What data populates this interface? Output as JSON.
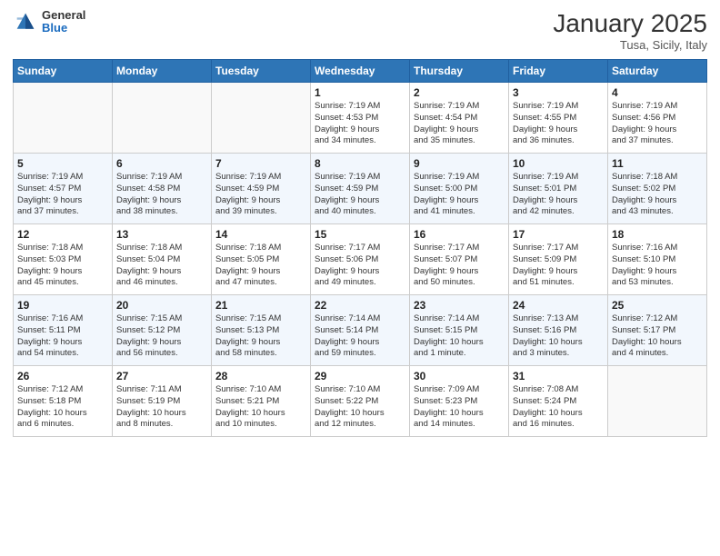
{
  "header": {
    "logo_general": "General",
    "logo_blue": "Blue",
    "month_title": "January 2025",
    "location": "Tusa, Sicily, Italy"
  },
  "weekdays": [
    "Sunday",
    "Monday",
    "Tuesday",
    "Wednesday",
    "Thursday",
    "Friday",
    "Saturday"
  ],
  "weeks": [
    [
      {
        "day": "",
        "info": ""
      },
      {
        "day": "",
        "info": ""
      },
      {
        "day": "",
        "info": ""
      },
      {
        "day": "1",
        "info": "Sunrise: 7:19 AM\nSunset: 4:53 PM\nDaylight: 9 hours\nand 34 minutes."
      },
      {
        "day": "2",
        "info": "Sunrise: 7:19 AM\nSunset: 4:54 PM\nDaylight: 9 hours\nand 35 minutes."
      },
      {
        "day": "3",
        "info": "Sunrise: 7:19 AM\nSunset: 4:55 PM\nDaylight: 9 hours\nand 36 minutes."
      },
      {
        "day": "4",
        "info": "Sunrise: 7:19 AM\nSunset: 4:56 PM\nDaylight: 9 hours\nand 37 minutes."
      }
    ],
    [
      {
        "day": "5",
        "info": "Sunrise: 7:19 AM\nSunset: 4:57 PM\nDaylight: 9 hours\nand 37 minutes."
      },
      {
        "day": "6",
        "info": "Sunrise: 7:19 AM\nSunset: 4:58 PM\nDaylight: 9 hours\nand 38 minutes."
      },
      {
        "day": "7",
        "info": "Sunrise: 7:19 AM\nSunset: 4:59 PM\nDaylight: 9 hours\nand 39 minutes."
      },
      {
        "day": "8",
        "info": "Sunrise: 7:19 AM\nSunset: 4:59 PM\nDaylight: 9 hours\nand 40 minutes."
      },
      {
        "day": "9",
        "info": "Sunrise: 7:19 AM\nSunset: 5:00 PM\nDaylight: 9 hours\nand 41 minutes."
      },
      {
        "day": "10",
        "info": "Sunrise: 7:19 AM\nSunset: 5:01 PM\nDaylight: 9 hours\nand 42 minutes."
      },
      {
        "day": "11",
        "info": "Sunrise: 7:18 AM\nSunset: 5:02 PM\nDaylight: 9 hours\nand 43 minutes."
      }
    ],
    [
      {
        "day": "12",
        "info": "Sunrise: 7:18 AM\nSunset: 5:03 PM\nDaylight: 9 hours\nand 45 minutes."
      },
      {
        "day": "13",
        "info": "Sunrise: 7:18 AM\nSunset: 5:04 PM\nDaylight: 9 hours\nand 46 minutes."
      },
      {
        "day": "14",
        "info": "Sunrise: 7:18 AM\nSunset: 5:05 PM\nDaylight: 9 hours\nand 47 minutes."
      },
      {
        "day": "15",
        "info": "Sunrise: 7:17 AM\nSunset: 5:06 PM\nDaylight: 9 hours\nand 49 minutes."
      },
      {
        "day": "16",
        "info": "Sunrise: 7:17 AM\nSunset: 5:07 PM\nDaylight: 9 hours\nand 50 minutes."
      },
      {
        "day": "17",
        "info": "Sunrise: 7:17 AM\nSunset: 5:09 PM\nDaylight: 9 hours\nand 51 minutes."
      },
      {
        "day": "18",
        "info": "Sunrise: 7:16 AM\nSunset: 5:10 PM\nDaylight: 9 hours\nand 53 minutes."
      }
    ],
    [
      {
        "day": "19",
        "info": "Sunrise: 7:16 AM\nSunset: 5:11 PM\nDaylight: 9 hours\nand 54 minutes."
      },
      {
        "day": "20",
        "info": "Sunrise: 7:15 AM\nSunset: 5:12 PM\nDaylight: 9 hours\nand 56 minutes."
      },
      {
        "day": "21",
        "info": "Sunrise: 7:15 AM\nSunset: 5:13 PM\nDaylight: 9 hours\nand 58 minutes."
      },
      {
        "day": "22",
        "info": "Sunrise: 7:14 AM\nSunset: 5:14 PM\nDaylight: 9 hours\nand 59 minutes."
      },
      {
        "day": "23",
        "info": "Sunrise: 7:14 AM\nSunset: 5:15 PM\nDaylight: 10 hours\nand 1 minute."
      },
      {
        "day": "24",
        "info": "Sunrise: 7:13 AM\nSunset: 5:16 PM\nDaylight: 10 hours\nand 3 minutes."
      },
      {
        "day": "25",
        "info": "Sunrise: 7:12 AM\nSunset: 5:17 PM\nDaylight: 10 hours\nand 4 minutes."
      }
    ],
    [
      {
        "day": "26",
        "info": "Sunrise: 7:12 AM\nSunset: 5:18 PM\nDaylight: 10 hours\nand 6 minutes."
      },
      {
        "day": "27",
        "info": "Sunrise: 7:11 AM\nSunset: 5:19 PM\nDaylight: 10 hours\nand 8 minutes."
      },
      {
        "day": "28",
        "info": "Sunrise: 7:10 AM\nSunset: 5:21 PM\nDaylight: 10 hours\nand 10 minutes."
      },
      {
        "day": "29",
        "info": "Sunrise: 7:10 AM\nSunset: 5:22 PM\nDaylight: 10 hours\nand 12 minutes."
      },
      {
        "day": "30",
        "info": "Sunrise: 7:09 AM\nSunset: 5:23 PM\nDaylight: 10 hours\nand 14 minutes."
      },
      {
        "day": "31",
        "info": "Sunrise: 7:08 AM\nSunset: 5:24 PM\nDaylight: 10 hours\nand 16 minutes."
      },
      {
        "day": "",
        "info": ""
      }
    ]
  ]
}
